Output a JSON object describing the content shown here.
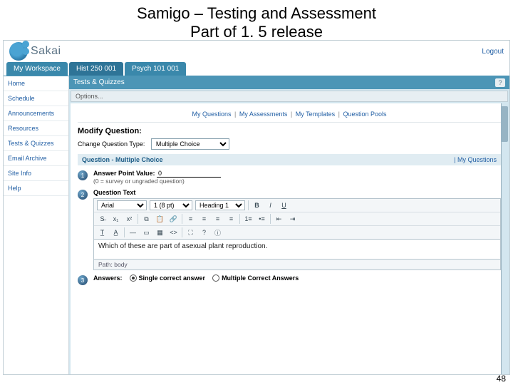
{
  "slide": {
    "title_line1": "Samigo – Testing and Assessment",
    "title_line2": "Part of 1. 5 release",
    "number": "48"
  },
  "header": {
    "logo_text": "Sakai",
    "logout": "Logout"
  },
  "site_tabs": [
    {
      "label": "My Workspace",
      "selected": false
    },
    {
      "label": "Hist 250 001",
      "selected": true
    },
    {
      "label": "Psych 101 001",
      "selected": false
    }
  ],
  "leftnav": [
    "Home",
    "Schedule",
    "Announcements",
    "Resources",
    "Tests & Quizzes",
    "Email Archive",
    "Site Info",
    "Help"
  ],
  "tool": {
    "title": "Tests & Quizzes",
    "options": "Options...",
    "help_glyph": "?"
  },
  "subnav": {
    "items": [
      "My Questions",
      "My Assessments",
      "My Templates",
      "Question Pools"
    ]
  },
  "modify": {
    "heading": "Modify Question:",
    "change_type_label": "Change Question Type:",
    "change_type_value": "Multiple Choice"
  },
  "qband": {
    "label": "Question - Multiple Choice",
    "right": "| My Questions"
  },
  "step1": {
    "num": "1",
    "label": "Answer Point Value:",
    "value": "0",
    "hint": "(0 = survey or ungraded question)"
  },
  "step2": {
    "num": "2",
    "label": "Question Text",
    "font_family": "Arial",
    "font_size": "1 (8 pt)",
    "block_format": "Heading 1",
    "editor_text": "Which of these are part of asexual plant reproduction.",
    "path_label": "Path:",
    "path_value": "body"
  },
  "step3": {
    "num": "3",
    "label": "Answers:",
    "opt_single": "Single correct answer",
    "opt_multiple": "Multiple Correct Answers"
  }
}
